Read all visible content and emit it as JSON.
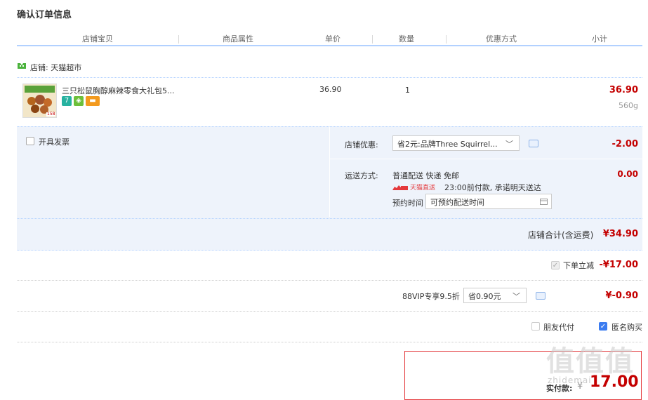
{
  "page_title": "确认订单信息",
  "columns": [
    "店铺宝贝",
    "商品属性",
    "单价",
    "数量",
    "优惠方式",
    "小计"
  ],
  "shop": {
    "label": "店铺: 天猫超市"
  },
  "product": {
    "name": "三只松鼠胸醇麻辣零食大礼包5...",
    "thumb_badge": "158",
    "price": "36.90",
    "quantity": "1",
    "subtotal": "36.90",
    "weight": "560g",
    "badges": [
      {
        "text": "7",
        "color": "#27b2a0"
      },
      {
        "text": "◈",
        "color": "#6cbf3a"
      },
      {
        "text": "▬",
        "color": "#f39a1e"
      }
    ]
  },
  "invoice": {
    "label": "开具发票",
    "checked": false
  },
  "shop_discount": {
    "label": "店铺优惠:",
    "selected": "省2元:品牌Three Squirrel...",
    "amount": "-2.00"
  },
  "shipping": {
    "label": "运送方式:",
    "method": "普通配送 快递 免邮",
    "brand": "天猫直送",
    "promise": "23:00前付款, 承诺明天送达",
    "schedule_label": "预约时间",
    "schedule_placeholder": "可预约配送时间",
    "amount": "0.00"
  },
  "shop_total": {
    "label": "店铺合计(含运费)",
    "amount": "¥34.90"
  },
  "instant_discount": {
    "label": "下单立减",
    "amount": "-¥17.00",
    "checked": true
  },
  "vip": {
    "label": "88VIP专享9.5折",
    "selected": "省0.90元",
    "amount": "¥-0.90"
  },
  "friend_pay": {
    "label": "朋友代付",
    "checked": false
  },
  "anonymous": {
    "label": "匿名购买",
    "checked": true
  },
  "payment": {
    "label": "实付款:",
    "currency": "¥",
    "amount": "17.00"
  },
  "colors": {
    "accent": "#c40000",
    "header_line": "#b2d1ff",
    "panel": "#eef3fb"
  }
}
